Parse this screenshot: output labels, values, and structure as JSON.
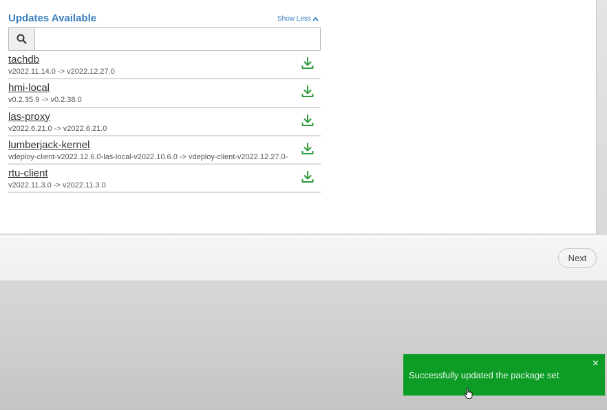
{
  "updates": {
    "heading": "Updates Available",
    "toggle_label": "Show Less",
    "search": {
      "value": "",
      "placeholder": ""
    },
    "items": [
      {
        "name": "tachdb",
        "version": "v2022.11.14.0 -> v2022.12.27.0"
      },
      {
        "name": "hmi-local",
        "version": "v0.2.35.9 -> v0.2.38.0"
      },
      {
        "name": "las-proxy",
        "version": "v2022.6.21.0 -> v2022.6.21.0"
      },
      {
        "name": "lumberjack-kernel",
        "version": "vdeploy-client-v2022.12.6.0-las-local-v2022.10.6.0 -> vdeploy-client-v2022.12.27.0-"
      },
      {
        "name": "rtu-client",
        "version": "v2022.11.3.0 -> v2022.11.3.0"
      }
    ]
  },
  "footer": {
    "next_label": "Next"
  },
  "toast": {
    "message": "Successfully updated the package set",
    "close_symbol": "×"
  },
  "colors": {
    "accent": "#3a7fc0",
    "download_icon": "#2e9a3a",
    "toast_bg": "#0d9d27"
  },
  "icons": {
    "search": "search-icon",
    "download": "download-icon",
    "toggle": "chevron-up-icon",
    "close": "close-icon"
  }
}
